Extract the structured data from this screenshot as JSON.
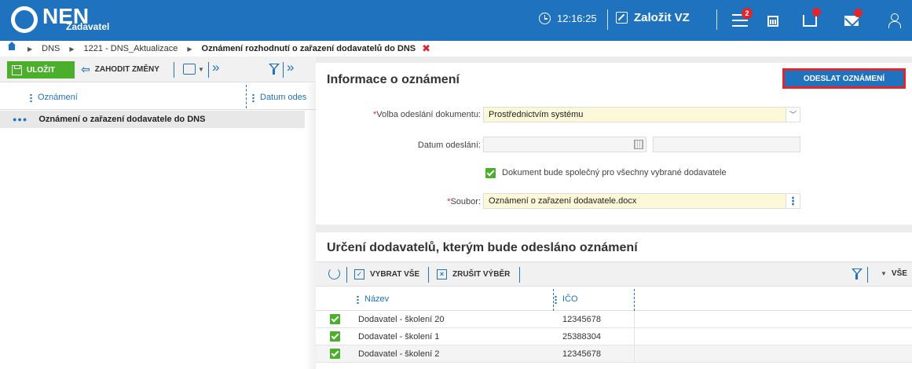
{
  "header": {
    "logo": "NEN",
    "logo_sub": "Zadavatel",
    "clock": "12:16:25",
    "create_label": "Založit VZ",
    "menu_badge": "2",
    "brand_color": "#1e72be",
    "alert_color": "#e0262a"
  },
  "breadcrumb": {
    "items": [
      "DNS",
      "1221 - DNS_Aktualizace",
      "Oznámení rozhodnutí o zařazení dodavatelů do DNS"
    ]
  },
  "left_toolbar": {
    "save_label": "ULOŽIT",
    "discard_label": "ZAHODIT ZMĚNY"
  },
  "left_grid": {
    "columns": [
      "Oznámení",
      "Datum odes"
    ],
    "rows": [
      "Oznámení o zařazení dodavatele do DNS"
    ]
  },
  "info": {
    "title": "Informace o oznámení",
    "send_label": "ODESLAT OZNÁMENÍ",
    "send_method_label": "Volba odeslání dokumentu:",
    "send_method_value": "Prostřednictvím systému",
    "send_date_label": "Datum odeslání:",
    "common_doc_label": "Dokument bude společný pro všechny vybrané dodavatele",
    "file_label": "Soubor:",
    "file_value": "Oznámení o zařazení dodavatele.docx"
  },
  "suppliers": {
    "title": "Určení dodavatelů, kterým bude odesláno oznámení",
    "select_all_label": "VYBRAT VŠE",
    "deselect_label": "ZRUŠIT VÝBĚR",
    "filter_all_label": "VŠE",
    "columns": [
      "Název",
      "IČO"
    ],
    "rows": [
      {
        "name": "Dodavatel - školení 20",
        "ico": "12345678"
      },
      {
        "name": "Dodavatel - školení 1",
        "ico": "25388304"
      },
      {
        "name": "Dodavatel - školení 2",
        "ico": "12345678"
      }
    ]
  }
}
